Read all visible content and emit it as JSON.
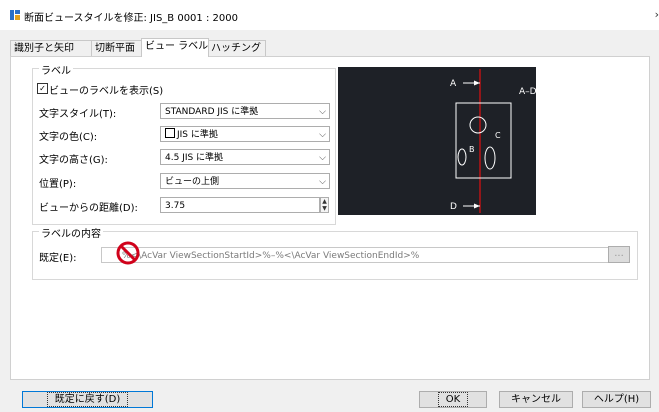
{
  "window": {
    "title": "断面ビュースタイルを修正: JIS_B 0001 : 2000",
    "close_glyph": "›"
  },
  "tabs": [
    {
      "label": "識別子と矢印"
    },
    {
      "label": "切断平面"
    },
    {
      "label": "ビュー ラベル"
    },
    {
      "label": "ハッチング"
    }
  ],
  "label_group": {
    "title": "ラベル",
    "show_label": {
      "label": "ビューのラベルを表示(S)",
      "checked": true,
      "check_glyph": "✓"
    },
    "text_style": {
      "label": "文字スタイル(T):",
      "value": "STANDARD JIS に準拠"
    },
    "text_color": {
      "label": "文字の色(C):",
      "value": "JIS に準拠",
      "swatch": "#ffffff"
    },
    "text_height": {
      "label": "文字の高さ(G):",
      "value": "4.5 JIS に準拠"
    },
    "position": {
      "label": "位置(P):",
      "value": "ビューの上側"
    },
    "distance": {
      "label": "ビューからの距離(D):",
      "value": "3.75"
    }
  },
  "preview": {
    "label_a": "A",
    "label_ad": "A–D",
    "label_b": "B",
    "label_c": "C",
    "label_d": "D",
    "background": "#1e2127",
    "cut_line_color": "#e01010"
  },
  "contents_group": {
    "title": "ラベルの内容",
    "default_label": "既定(E):",
    "default_value": "%<\\AcVar ViewSectionStartId>%–%<\\AcVar ViewSectionEndId>%",
    "browse_label": "..."
  },
  "footer": {
    "reset": "既定に戻す(D)",
    "ok": "OK",
    "cancel": "キャンセル",
    "help": "ヘルプ(H)"
  },
  "colors": {
    "accent": "#0078d7",
    "no_sign": "#d0021b"
  }
}
